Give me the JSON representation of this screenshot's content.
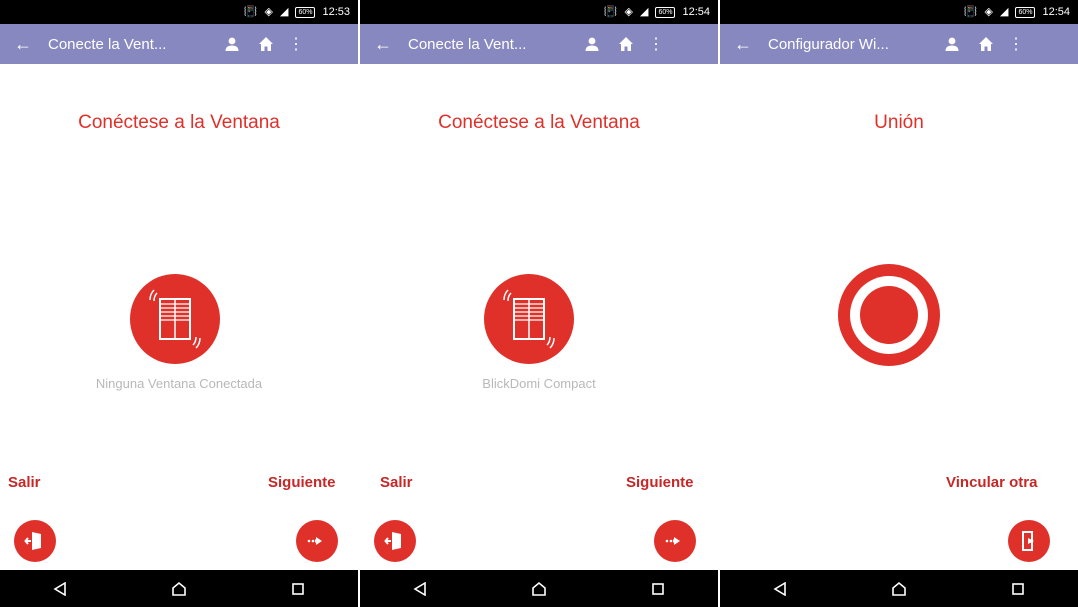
{
  "screens": [
    {
      "status_time": "12:53",
      "battery": "60%",
      "toolbar_title": "Conecte la Vent...",
      "heading": "Conéctese a la Ventana",
      "device_name": "Ninguna Ventana Conectada",
      "left_action": "Salir",
      "right_action": "Siguiente"
    },
    {
      "status_time": "12:54",
      "battery": "60%",
      "toolbar_title": "Conecte la Vent...",
      "heading": "Conéctese a la Ventana",
      "device_name": "BlickDomi Compact",
      "left_action": "Salir",
      "right_action": "Siguiente"
    },
    {
      "status_time": "12:54",
      "battery": "60%",
      "toolbar_title": "Configurador Wi...",
      "heading": "Unión",
      "right_action": "Vincular otra"
    }
  ],
  "colors": {
    "accent": "#e0302a",
    "label_red": "#c62828",
    "toolbar": "#8888c0",
    "system_bars": "#000000",
    "device_text": "#b8b8b8"
  },
  "icons": {
    "back": "arrow-left-icon",
    "user": "person-icon",
    "home": "home-icon",
    "menu": "more-vert-icon",
    "device": "window-shutter-icon",
    "exit": "exit-door-icon",
    "next": "arrow-right-icon",
    "link_other": "door-link-icon",
    "union": "record-target-icon"
  }
}
